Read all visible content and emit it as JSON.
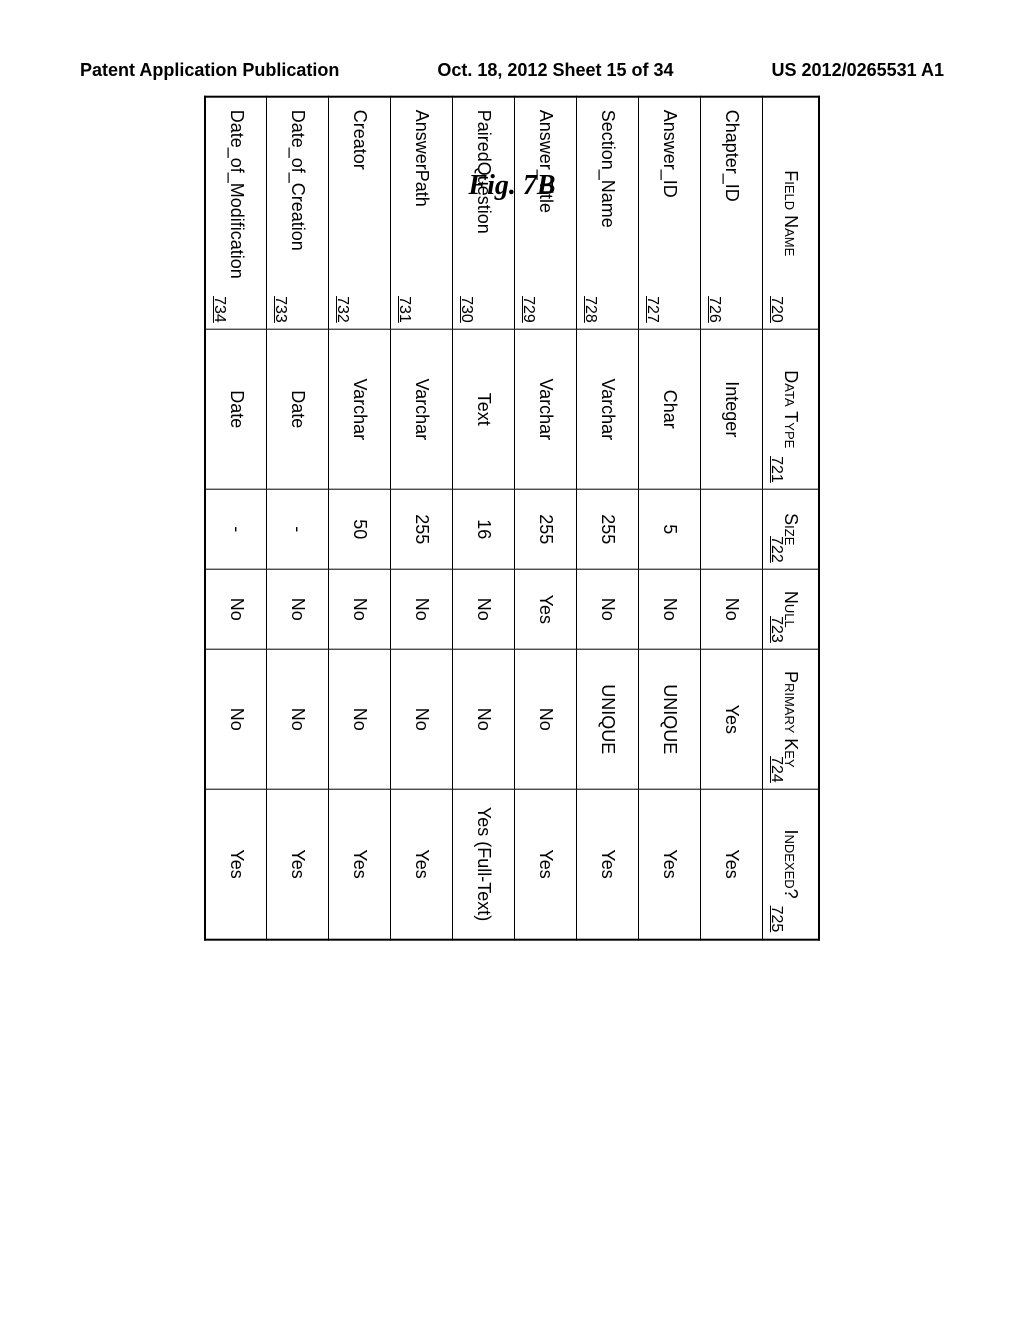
{
  "header": {
    "left": "Patent Application Publication",
    "center": "Oct. 18, 2012  Sheet 15 of 34",
    "right": "US 2012/0265531 A1"
  },
  "figure_label": "Fig. 7B",
  "table": {
    "columns": [
      {
        "label": "Field Name",
        "ref": "720"
      },
      {
        "label": "Data Type",
        "ref": "721"
      },
      {
        "label": "Size",
        "ref": "722"
      },
      {
        "label": "Null",
        "ref": "723"
      },
      {
        "label": "Primary Key",
        "ref": "724"
      },
      {
        "label": "Indexed?",
        "ref": "725"
      }
    ],
    "rows": [
      {
        "field": "Chapter_ID",
        "ref": "726",
        "data_type": "Integer",
        "size": "",
        "null": "No",
        "primary_key": "Yes",
        "indexed": "Yes"
      },
      {
        "field": "Answer_ID",
        "ref": "727",
        "data_type": "Char",
        "size": "5",
        "null": "No",
        "primary_key": "UNIQUE",
        "indexed": "Yes"
      },
      {
        "field": "Section_Name",
        "ref": "728",
        "data_type": "Varchar",
        "size": "255",
        "null": "No",
        "primary_key": "UNIQUE",
        "indexed": "Yes"
      },
      {
        "field": "Answer_Title",
        "ref": "729",
        "data_type": "Varchar",
        "size": "255",
        "null": "Yes",
        "primary_key": "No",
        "indexed": "Yes"
      },
      {
        "field": "PairedQuestion",
        "ref": "730",
        "data_type": "Text",
        "size": "16",
        "null": "No",
        "primary_key": "No",
        "indexed": "Yes (Full-Text)"
      },
      {
        "field": "AnswerPath",
        "ref": "731",
        "data_type": "Varchar",
        "size": "255",
        "null": "No",
        "primary_key": "No",
        "indexed": "Yes"
      },
      {
        "field": "Creator",
        "ref": "732",
        "data_type": "Varchar",
        "size": "50",
        "null": "No",
        "primary_key": "No",
        "indexed": "Yes"
      },
      {
        "field": "Date_of_Creation",
        "ref": "733",
        "data_type": "Date",
        "size": "-",
        "null": "No",
        "primary_key": "No",
        "indexed": "Yes"
      },
      {
        "field": "Date_of_Modification",
        "ref": "734",
        "data_type": "Date",
        "size": "-",
        "null": "No",
        "primary_key": "No",
        "indexed": "Yes"
      }
    ]
  }
}
